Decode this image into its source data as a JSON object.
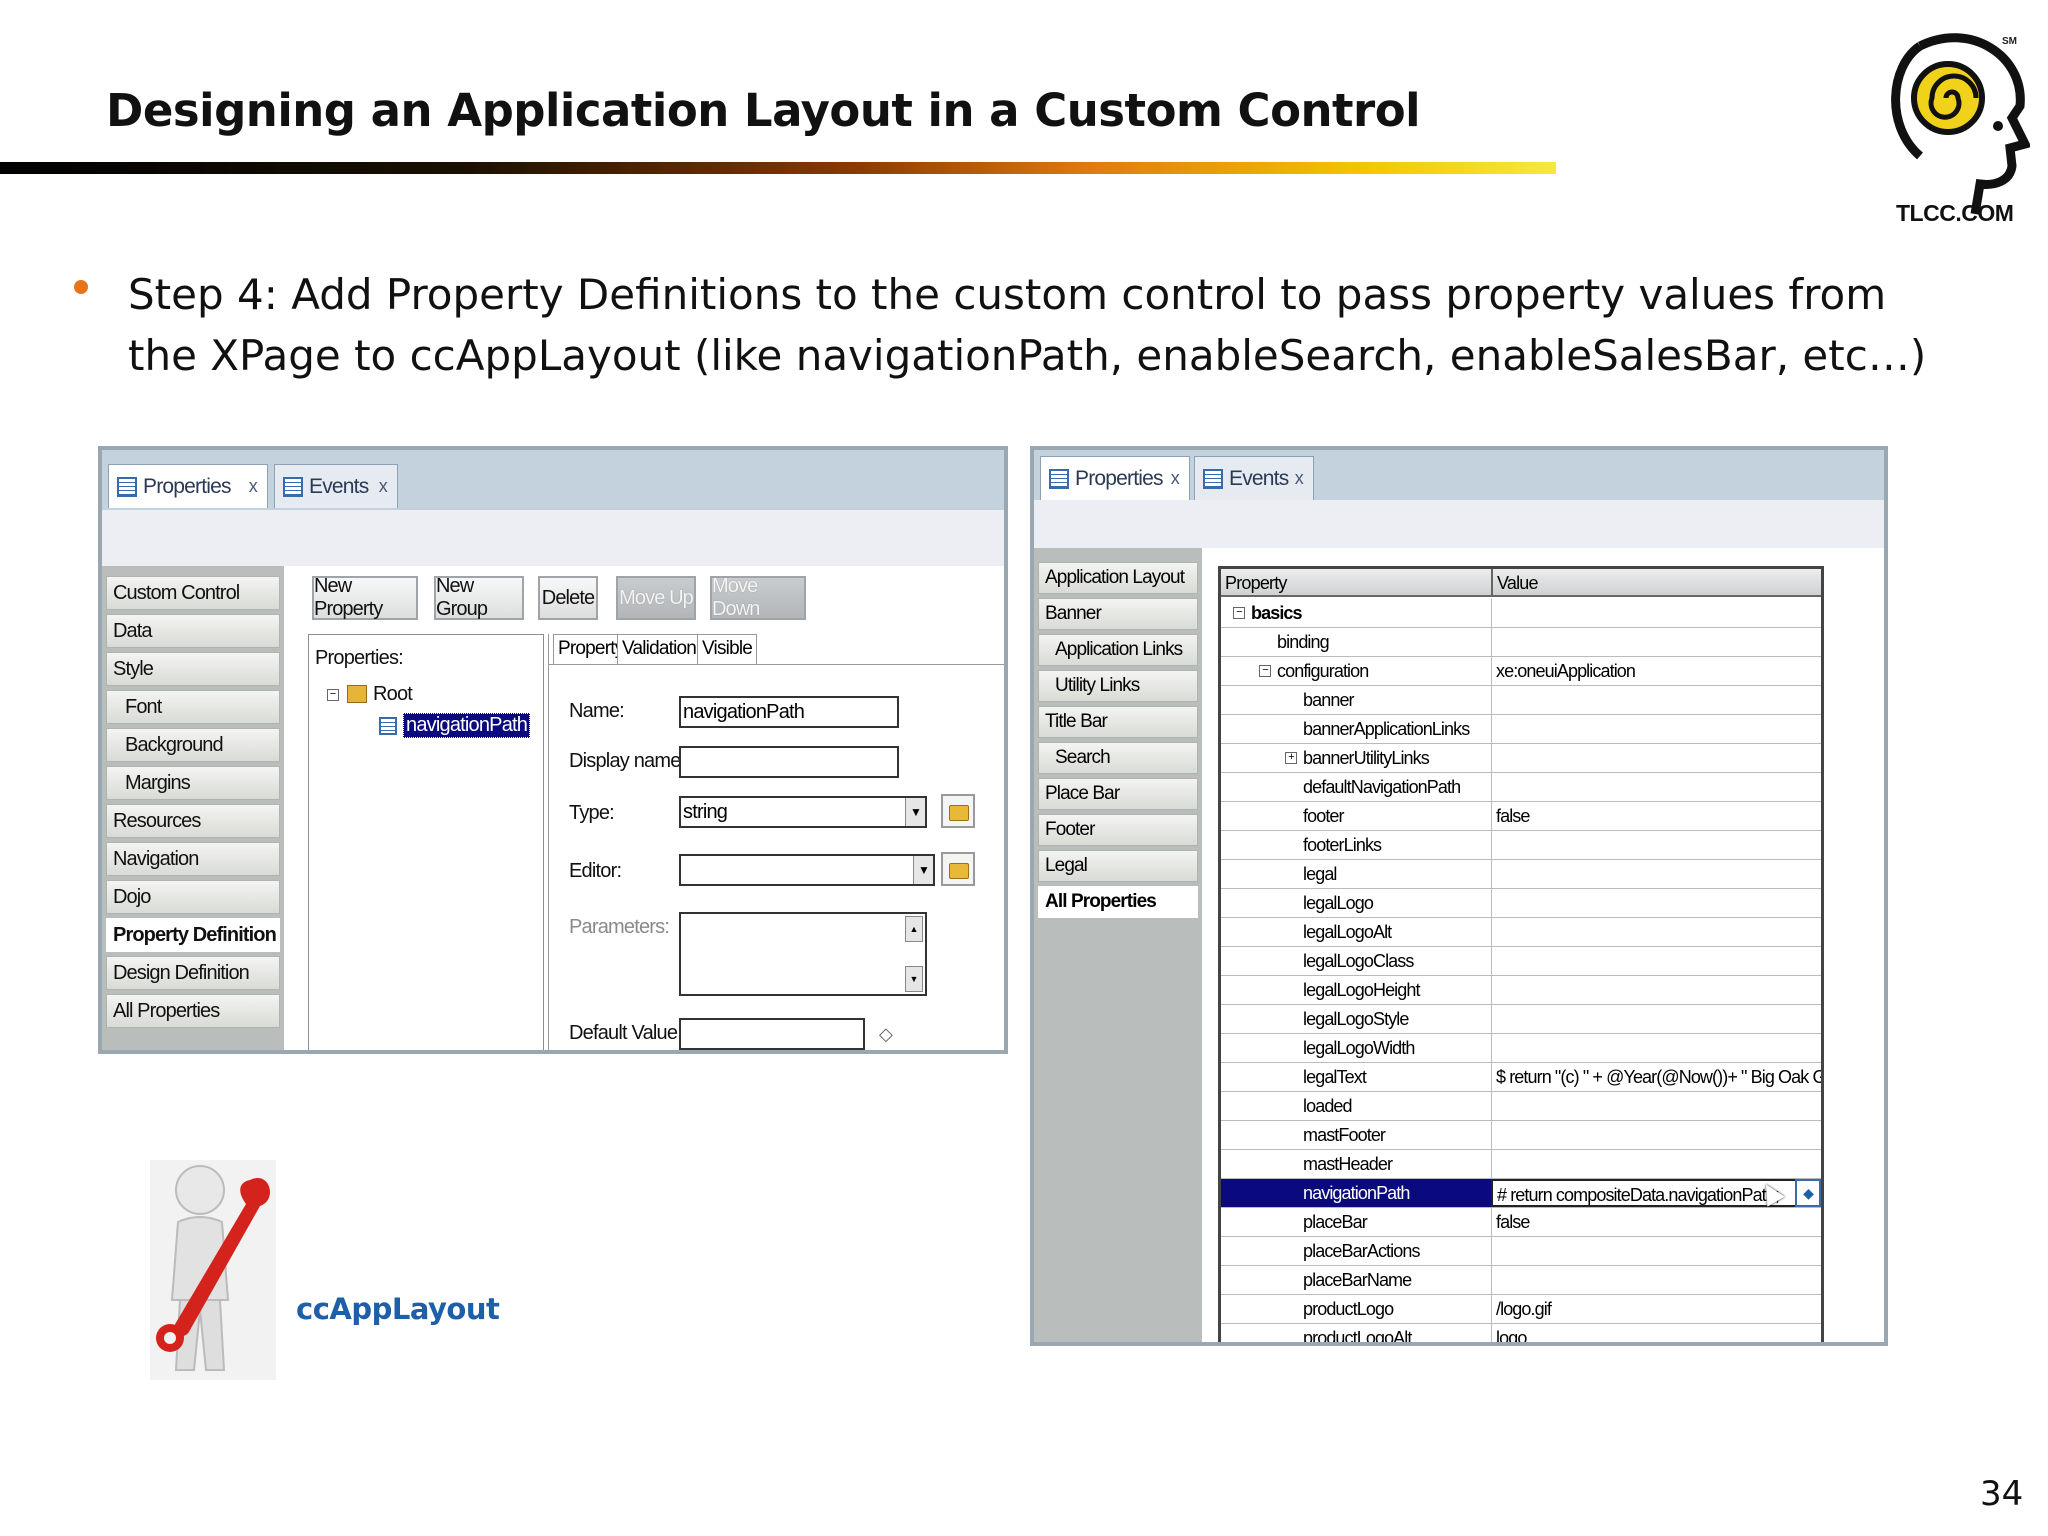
{
  "slide": {
    "title": "Designing an Application Layout in a Custom Control",
    "bullet": "Step 4: Add Property Definitions to the custom control to pass property values from the XPage to ccAppLayout (like navigationPath, enableSearch, enableSalesBar, etc…)",
    "logo_text": "TLCC.COM",
    "logo_mark": "SM",
    "figure_caption": "ccAppLayout",
    "page_number": "34",
    "colors": {
      "bullet": "#e8741a",
      "caption": "#1d5fa8",
      "rule_start": "#000000",
      "rule_end": "#f6e840"
    }
  },
  "left_panel": {
    "tabs": [
      {
        "label": "Properties",
        "close": "x",
        "icon": "properties-icon"
      },
      {
        "label": "Events",
        "close": "x",
        "icon": "events-icon"
      }
    ],
    "nav": [
      {
        "label": "Custom Control"
      },
      {
        "label": "Data"
      },
      {
        "label": "Style"
      },
      {
        "label": "Font"
      },
      {
        "label": "Background"
      },
      {
        "label": "Margins"
      },
      {
        "label": "Resources"
      },
      {
        "label": "Navigation"
      },
      {
        "label": "Dojo"
      },
      {
        "label": "Property Definition"
      },
      {
        "label": "Design Definition"
      },
      {
        "label": "All Properties"
      }
    ],
    "buttons": [
      "New Property",
      "New Group",
      "Delete",
      "Move Up",
      "Move Down"
    ],
    "tree": {
      "heading": "Properties:",
      "root": "Root",
      "child": "navigationPath"
    },
    "inner_tabs": [
      "Property",
      "Validation",
      "Visible"
    ],
    "form": {
      "name_label": "Name:",
      "name_value": "navigationPath",
      "display_label": "Display name:",
      "display_value": "",
      "type_label": "Type:",
      "type_value": "string",
      "editor_label": "Editor:",
      "editor_value": "",
      "params_label": "Parameters:",
      "default_label": "Default Value:",
      "default_value": ""
    }
  },
  "right_panel": {
    "tabs": [
      {
        "label": "Properties",
        "close": "x",
        "icon": "properties-icon"
      },
      {
        "label": "Events",
        "close": "x",
        "icon": "events-icon"
      }
    ],
    "nav": [
      {
        "label": "Application Layout"
      },
      {
        "label": "Banner"
      },
      {
        "label": "Application Links"
      },
      {
        "label": "Utility Links"
      },
      {
        "label": "Title Bar"
      },
      {
        "label": "Search"
      },
      {
        "label": "Place Bar"
      },
      {
        "label": "Footer"
      },
      {
        "label": "Legal"
      },
      {
        "label": "All Properties"
      }
    ],
    "grid_headers": {
      "property": "Property",
      "value": "Value"
    },
    "rows": [
      {
        "name": "basics",
        "value": "",
        "expander": "−"
      },
      {
        "name": "binding",
        "value": ""
      },
      {
        "name": "configuration",
        "value": "xe:oneuiApplication",
        "expander": "−"
      },
      {
        "name": "banner",
        "value": ""
      },
      {
        "name": "bannerApplicationLinks",
        "value": ""
      },
      {
        "name": "bannerUtilityLinks",
        "value": "",
        "expander": "+"
      },
      {
        "name": "defaultNavigationPath",
        "value": ""
      },
      {
        "name": "footer",
        "value": "false"
      },
      {
        "name": "footerLinks",
        "value": ""
      },
      {
        "name": "legal",
        "value": ""
      },
      {
        "name": "legalLogo",
        "value": ""
      },
      {
        "name": "legalLogoAlt",
        "value": ""
      },
      {
        "name": "legalLogoClass",
        "value": ""
      },
      {
        "name": "legalLogoHeight",
        "value": ""
      },
      {
        "name": "legalLogoStyle",
        "value": ""
      },
      {
        "name": "legalLogoWidth",
        "value": ""
      },
      {
        "name": "legalText",
        "value": "$ return \"(c) \" + @Year(@Now())+ \" Big Oak Golf\""
      },
      {
        "name": "loaded",
        "value": ""
      },
      {
        "name": "mastFooter",
        "value": ""
      },
      {
        "name": "mastHeader",
        "value": ""
      },
      {
        "name": "navigationPath",
        "value": "# return compositeData.navigationPath;",
        "selected": true
      },
      {
        "name": "placeBar",
        "value": "false"
      },
      {
        "name": "placeBarActions",
        "value": ""
      },
      {
        "name": "placeBarName",
        "value": ""
      },
      {
        "name": "productLogo",
        "value": "/logo.gif"
      },
      {
        "name": "productLogoAlt",
        "value": "logo"
      }
    ]
  }
}
